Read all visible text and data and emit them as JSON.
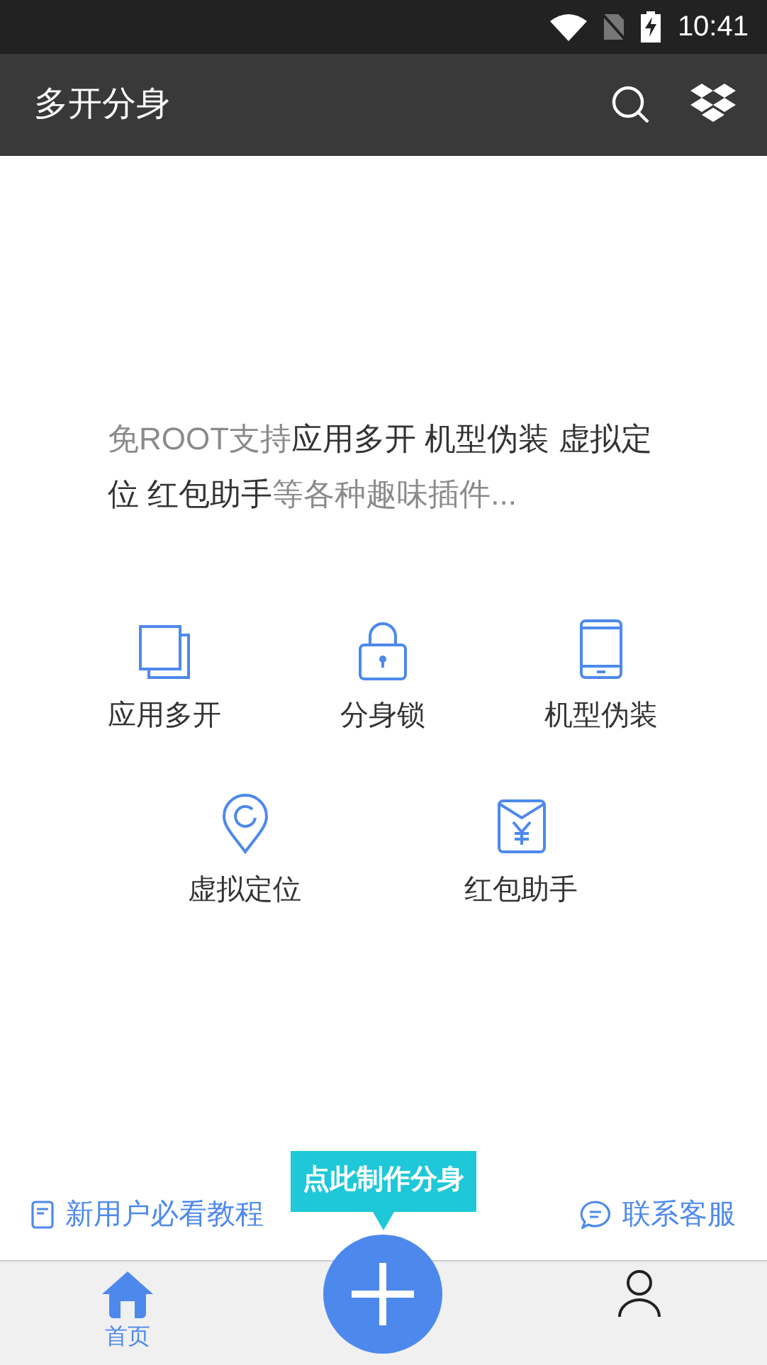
{
  "status_bar": {
    "time": "10:41"
  },
  "app_bar": {
    "title": "多开分身"
  },
  "intro": [
    {
      "text": "免ROOT支持",
      "emphasis": false
    },
    {
      "text": "应用多开 机型伪装 虚拟定位 红包助手",
      "emphasis": true
    },
    {
      "text": "等各种趣味插件...",
      "emphasis": false
    }
  ],
  "features": [
    {
      "label": "应用多开",
      "kind": "copies"
    },
    {
      "label": "分身锁",
      "kind": "lock"
    },
    {
      "label": "机型伪装",
      "kind": "phone"
    },
    {
      "label": "虚拟定位",
      "kind": "pin"
    },
    {
      "label": "红包助手",
      "kind": "envelope"
    }
  ],
  "links": [
    {
      "label": "新用户必看教程",
      "kind": "tutorial"
    },
    {
      "label": "联系客服",
      "kind": "support"
    }
  ],
  "create_tooltip": "点此制作分身",
  "tabs": [
    {
      "label": "首页",
      "kind": "home",
      "selected": true
    },
    {
      "kind": "person",
      "selected": false
    }
  ]
}
